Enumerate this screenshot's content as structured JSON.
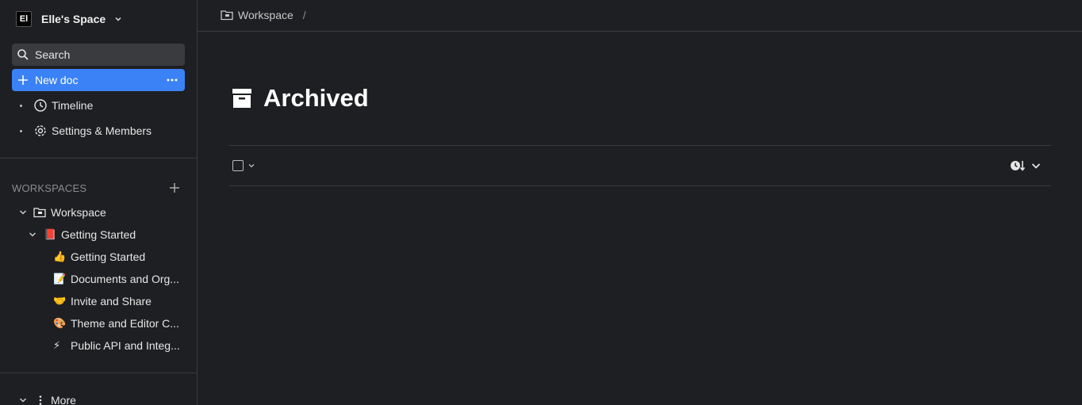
{
  "workspace": {
    "avatar": "El",
    "name": "Elle's Space"
  },
  "sidebar": {
    "search_label": "Search",
    "newdoc_label": "New doc",
    "nav": [
      {
        "label": "Timeline",
        "icon": "clock-icon"
      },
      {
        "label": "Settings & Members",
        "icon": "gear-icon"
      }
    ],
    "workspaces_header": "WORKSPACES",
    "tree": [
      {
        "label": "Workspace",
        "icon": "folder-icon",
        "level": 0
      },
      {
        "label": "Getting Started",
        "emoji": "📕",
        "level": 1
      },
      {
        "label": "Getting Started",
        "emoji": "👍",
        "level": 2
      },
      {
        "label": "Documents and Org...",
        "emoji": "📝",
        "level": 2
      },
      {
        "label": "Invite and Share",
        "emoji": "🤝",
        "level": 2
      },
      {
        "label": "Theme and Editor C...",
        "emoji": "🎨",
        "level": 2
      },
      {
        "label": "Public API and Integ...",
        "emoji": "⚡",
        "level": 2
      }
    ],
    "more_label": "More"
  },
  "breadcrumb": {
    "item": "Workspace",
    "separator": "/"
  },
  "page": {
    "title": "Archived",
    "icon": "archive-icon"
  },
  "colors": {
    "background": "#1e1f22",
    "accent": "#3b82f6",
    "input_bg": "#3a3b3f"
  }
}
